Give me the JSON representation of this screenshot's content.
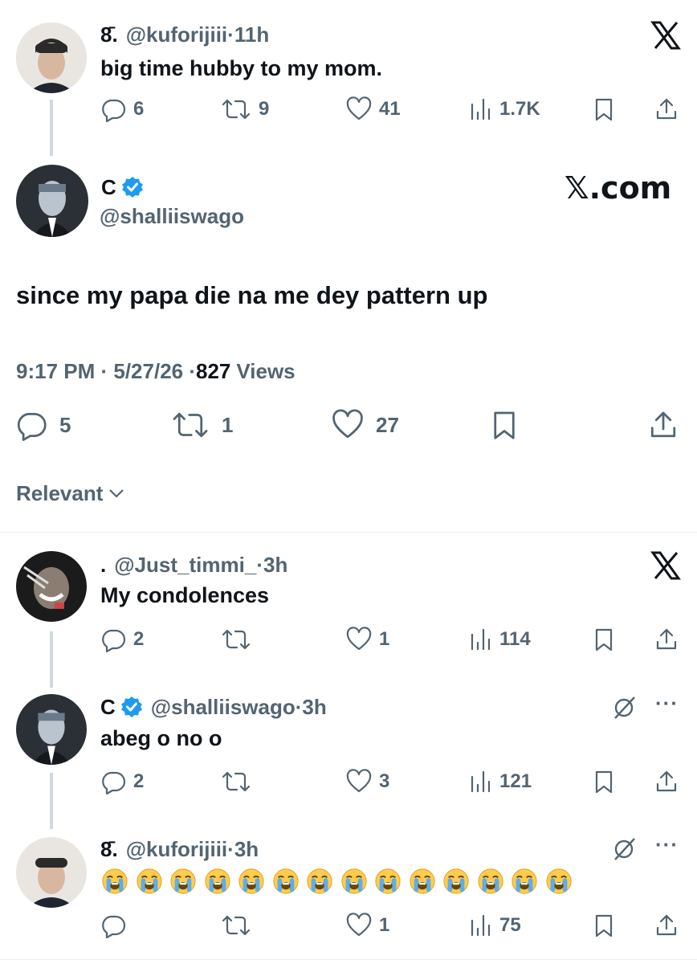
{
  "quoted_post": {
    "display_name": "8̄.",
    "handle": "@kuforijiii",
    "time": "11h",
    "text": "big time hubby to my mom.",
    "replies": "6",
    "reposts": "9",
    "likes": "41",
    "views": "1.7K"
  },
  "main_post": {
    "display_name": "C",
    "handle": "@shalliiswago",
    "watermark": "𝕏.com",
    "text": "since my papa die na me dey pattern up",
    "timestamp": "9:17 PM · 5/27/26 · ",
    "views_count": "827",
    "views_label": "Views",
    "replies": "5",
    "reposts": "1",
    "likes": "27"
  },
  "sort": {
    "label": "Relevant"
  },
  "reply_1": {
    "display_name": ".",
    "handle": "@Just_timmi_",
    "time": "3h",
    "text": "My condolences",
    "replies": "2",
    "reposts": "",
    "likes": "1",
    "views": "114"
  },
  "reply_2": {
    "display_name": "C",
    "handle": "@shalliiswago",
    "time": "3h",
    "text": "abeg o no o",
    "replies": "2",
    "reposts": "",
    "likes": "3",
    "views": "121"
  },
  "reply_3": {
    "display_name": "8̄.",
    "handle": "@kuforijiii",
    "time": "3h",
    "emoji_count": 14,
    "replies": "",
    "reposts": "",
    "likes": "1",
    "views": "75"
  },
  "sep": " · ",
  "icons": {
    "close": "x-logo-icon",
    "verified": "verified-badge-icon",
    "reply": "reply-icon",
    "repost": "repost-icon",
    "like": "heart-icon",
    "views": "views-icon",
    "bookmark": "bookmark-icon",
    "share": "share-icon",
    "grok": "grok-icon",
    "more": "more-icon",
    "chevron": "chevron-down-icon",
    "emoji": "loudly-crying-face-icon"
  },
  "colors": {
    "text": "#0f1419",
    "secondary": "#536471",
    "verified": "#1d9bf0",
    "line": "#cfd9de"
  }
}
